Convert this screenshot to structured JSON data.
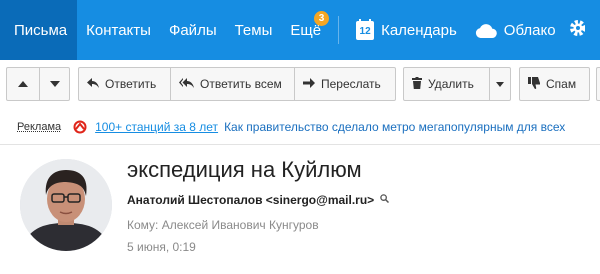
{
  "nav": {
    "items": [
      {
        "label": "Письма",
        "active": true
      },
      {
        "label": "Контакты"
      },
      {
        "label": "Файлы"
      },
      {
        "label": "Темы"
      },
      {
        "label": "Ещё",
        "badge": "3"
      }
    ],
    "calendar": {
      "label": "Календарь",
      "icon": "calendar-icon",
      "day": "12"
    },
    "cloud": {
      "label": "Облако",
      "icon": "cloud-icon"
    },
    "settings_icon": "gear-icon",
    "colors": {
      "bar": "#168de2",
      "active": "#0a6bb8",
      "badge": "#f5a623"
    }
  },
  "toolbar": {
    "up_icon": "arrow-up-icon",
    "down_icon": "arrow-down-icon",
    "reply": "Ответить",
    "reply_all": "Ответить всем",
    "forward": "Переслать",
    "delete": "Удалить",
    "spam": "Спам"
  },
  "ad": {
    "label": "Реклама",
    "link": "100+ станций за 8 лет",
    "text": "Как правительство сделало метро мегапопулярным для всех"
  },
  "message": {
    "subject": "экспедиция на Куйлюм",
    "sender": "Анатолий Шестопалов <sinergo@mail.ru>",
    "to": "Кому: Алексей Иванович Кунгуров",
    "date": "5 июня, 0:19"
  }
}
